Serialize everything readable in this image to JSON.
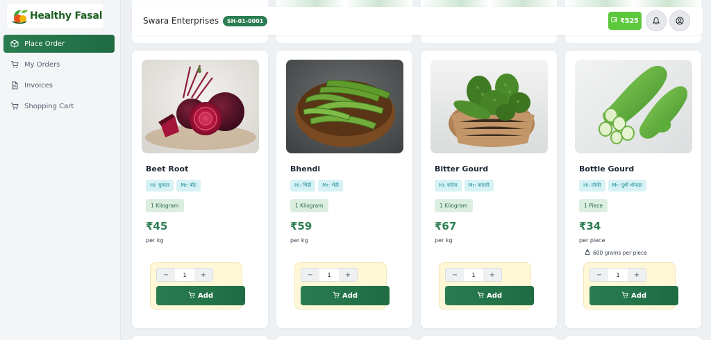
{
  "brand": {
    "name": "Healthy Fasal"
  },
  "sidebar": {
    "items": [
      {
        "label": "Place Order",
        "icon": "box-icon",
        "active": true
      },
      {
        "label": "My Orders",
        "icon": "cart-icon",
        "active": false
      },
      {
        "label": "Invoices",
        "icon": "document-icon",
        "active": false
      },
      {
        "label": "Shopping Cart",
        "icon": "cart-icon",
        "active": false
      }
    ]
  },
  "header": {
    "company": "Swara Enterprises",
    "code": "SH-01-0001",
    "wallet": "₹525"
  },
  "products": [
    {
      "name": "Beet Root",
      "hi": "Hi: चुकंदर",
      "mr": "Mr: बीट",
      "quantity": "1 Kilogram",
      "price": "₹45",
      "unit": "per kg",
      "weight": "",
      "count": "1",
      "add_label": "Add"
    },
    {
      "name": "Bhendi",
      "hi": "Hi: भिंडी",
      "mr": "Mr: भेंडी",
      "quantity": "1 Kilogram",
      "price": "₹59",
      "unit": "per kg",
      "weight": "",
      "count": "1",
      "add_label": "Add"
    },
    {
      "name": "Bitter Gourd",
      "hi": "Hi: करेला",
      "mr": "Mr: कारली",
      "quantity": "1 Kilogram",
      "price": "₹67",
      "unit": "per kg",
      "weight": "",
      "count": "1",
      "add_label": "Add"
    },
    {
      "name": "Bottle Gourd",
      "hi": "Hi: लौकी",
      "mr": "Mr: दुधी भोपळा",
      "quantity": "1 Piece",
      "price": "₹34",
      "unit": "per piece",
      "weight": "600 grams per piece",
      "count": "1",
      "add_label": "Add"
    }
  ],
  "colors": {
    "primary": "#2a7d50",
    "wallet": "#5cc93c",
    "tag_bg": "#d6f2f5",
    "buy_box_bg": "#fff7d6"
  }
}
